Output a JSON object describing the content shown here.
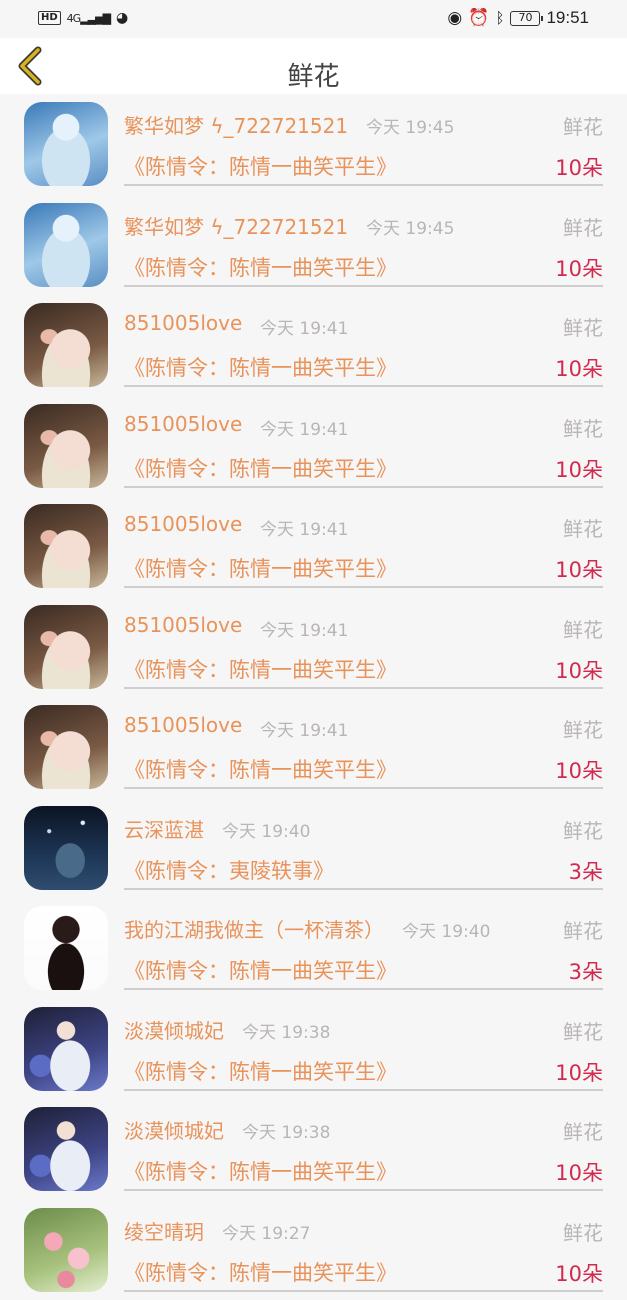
{
  "status_bar": {
    "hd": "HD",
    "network": "4G",
    "battery": "70",
    "time": "19:51"
  },
  "header": {
    "title": "鲜花"
  },
  "rows": [
    {
      "name": "繁华如梦 ϟ_722721521",
      "time": "今天 19:45",
      "gift": "鲜花",
      "drama": "《陈情令：陈情一曲笑平生》",
      "count": "10朵",
      "avatar": "fairy"
    },
    {
      "name": "繁华如梦 ϟ_722721521",
      "time": "今天 19:45",
      "gift": "鲜花",
      "drama": "《陈情令：陈情一曲笑平生》",
      "count": "10朵",
      "avatar": "fairy"
    },
    {
      "name": "851005love",
      "time": "今天 19:41",
      "gift": "鲜花",
      "drama": "《陈情令：陈情一曲笑平生》",
      "count": "10朵",
      "avatar": "pig"
    },
    {
      "name": "851005love",
      "time": "今天 19:41",
      "gift": "鲜花",
      "drama": "《陈情令：陈情一曲笑平生》",
      "count": "10朵",
      "avatar": "pig"
    },
    {
      "name": "851005love",
      "time": "今天 19:41",
      "gift": "鲜花",
      "drama": "《陈情令：陈情一曲笑平生》",
      "count": "10朵",
      "avatar": "pig"
    },
    {
      "name": "851005love",
      "time": "今天 19:41",
      "gift": "鲜花",
      "drama": "《陈情令：陈情一曲笑平生》",
      "count": "10朵",
      "avatar": "pig"
    },
    {
      "name": "851005love",
      "time": "今天 19:41",
      "gift": "鲜花",
      "drama": "《陈情令：陈情一曲笑平生》",
      "count": "10朵",
      "avatar": "pig"
    },
    {
      "name": "云深蓝湛",
      "time": "今天 19:40",
      "gift": "鲜花",
      "drama": "《陈情令：夷陵轶事》",
      "count": "3朵",
      "avatar": "night"
    },
    {
      "name": "我的江湖我做主（一杯清茶）",
      "time": "今天 19:40",
      "gift": "鲜花",
      "drama": "《陈情令：陈情一曲笑平生》",
      "count": "3朵",
      "avatar": "girl"
    },
    {
      "name": "淡漠倾城妃",
      "time": "今天 19:38",
      "gift": "鲜花",
      "drama": "《陈情令：陈情一曲笑平生》",
      "count": "10朵",
      "avatar": "man"
    },
    {
      "name": "淡漠倾城妃",
      "time": "今天 19:38",
      "gift": "鲜花",
      "drama": "《陈情令：陈情一曲笑平生》",
      "count": "10朵",
      "avatar": "man"
    },
    {
      "name": "绫空晴玥",
      "time": "今天 19:27",
      "gift": "鲜花",
      "drama": "《陈情令：陈情一曲笑平生》",
      "count": "10朵",
      "avatar": "flower"
    }
  ],
  "colors": {
    "name": "#e8935a",
    "count": "#d12a4e",
    "muted": "#b9b5b5",
    "back_arrow": "#d9b31a"
  }
}
